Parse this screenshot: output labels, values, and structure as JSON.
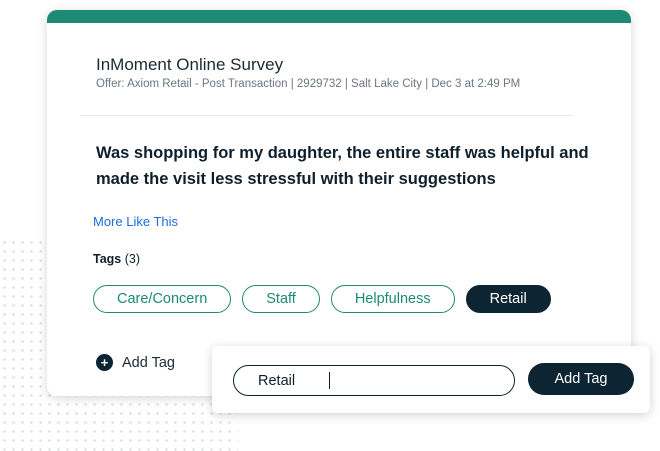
{
  "survey": {
    "title": "InMoment Online Survey",
    "offer": "Offer: Axiom Retail - Post Transaction | 2929732 | Salt Lake City | Dec 3 at 2:49 PM",
    "quote": "Was shopping for my daughter, the entire staff was helpful and made the visit less stressful with their suggestions",
    "more_link": "More Like This"
  },
  "tags": {
    "label": "Tags",
    "count": "(3)",
    "items": [
      "Care/Concern",
      "Staff",
      "Helpfulness",
      "Retail"
    ]
  },
  "add_tag": {
    "label": "Add Tag",
    "icon": "plus-circle-icon"
  },
  "popover": {
    "input_value": "Retail",
    "button_label": "Add Tag"
  },
  "colors": {
    "accent": "#1d8a73",
    "dark": "#0d2433",
    "link": "#1a6fe0"
  }
}
